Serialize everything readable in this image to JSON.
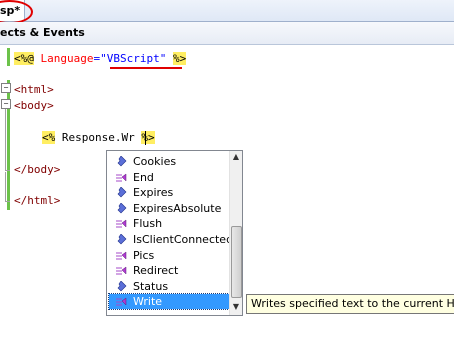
{
  "tab": {
    "title": "sp*"
  },
  "navbar": {
    "label": "ects & Events"
  },
  "code": {
    "line1": {
      "open": "<%@",
      "directive": "Language",
      "eq": "=",
      "value": "\"VBScript\"",
      "close": "%>"
    },
    "line2": {
      "text": "<html>"
    },
    "line3": {
      "text": "<body>"
    },
    "line4": {
      "open": "<%",
      "expr": "Response.Wr",
      "close": "%>"
    },
    "line5": {
      "text": "</body>"
    },
    "line6": {
      "text": "</html>"
    }
  },
  "completion": {
    "items": [
      {
        "label": "Cookies",
        "icon": "property-icon"
      },
      {
        "label": "End",
        "icon": "method-icon"
      },
      {
        "label": "Expires",
        "icon": "property-icon"
      },
      {
        "label": "ExpiresAbsolute",
        "icon": "property-icon"
      },
      {
        "label": "Flush",
        "icon": "method-icon"
      },
      {
        "label": "IsClientConnected",
        "icon": "property-icon"
      },
      {
        "label": "Pics",
        "icon": "method-icon"
      },
      {
        "label": "Redirect",
        "icon": "method-icon"
      },
      {
        "label": "Status",
        "icon": "property-icon"
      },
      {
        "label": "Write",
        "icon": "method-icon",
        "selected": true
      }
    ],
    "scroll_up": "▲",
    "scroll_down": "▼"
  },
  "tooltip": {
    "text": "Writes specified text to the current HTTP o"
  },
  "colors": {
    "selection": "#3399ff",
    "delimiter_bg": "#ffee62",
    "highlight_circle": "#e00000",
    "changebar": "#6cc24a"
  }
}
